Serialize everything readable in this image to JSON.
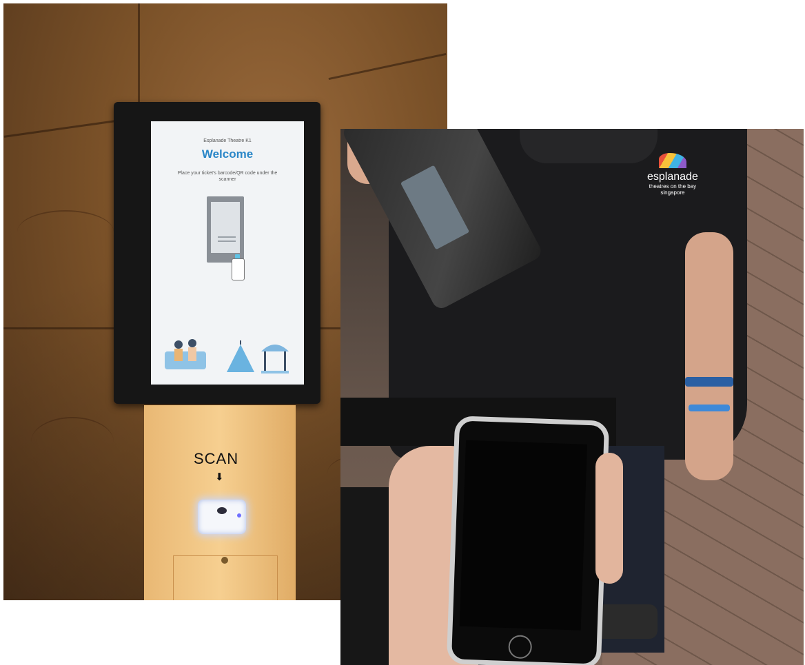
{
  "left_photo": {
    "kiosk_screen": {
      "status_text": "",
      "venue_title": "Esplanade Theatre K1",
      "welcome_heading": "Welcome",
      "instruction": "Place your ticket's barcode/QR code under the scanner"
    },
    "stand": {
      "scan_label": "SCAN",
      "arrow_glyph": "⬇"
    }
  },
  "right_photo": {
    "shirt_logo": {
      "name": "esplanade",
      "tagline_line1": "theatres on the bay",
      "tagline_line2": "singapore"
    }
  },
  "colors": {
    "welcome_blue": "#2b87c8",
    "stand_orange": "#f6cf90",
    "stone_brown": "#7a5128",
    "scanner_glow": "#c8d7ff"
  }
}
